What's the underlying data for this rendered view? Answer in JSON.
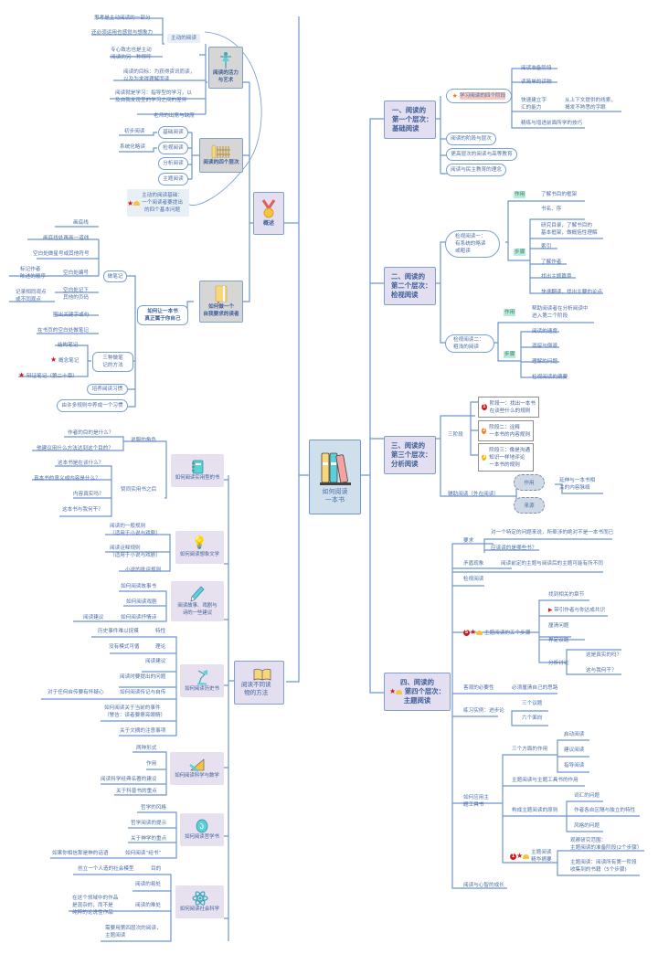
{
  "central": {
    "title_line1": "如何阅读",
    "title_line2": "一本书",
    "icon": "books-icon"
  },
  "right": {
    "level1": {
      "title": [
        "一、阅读的",
        "第一个层次：",
        "基础阅读"
      ],
      "stages_label": "学习阅读的四个阶段",
      "stages": [
        "阅读准备阶段",
        "读简单的读物",
        "快速建立字\n汇的能力",
        "精练与增进前面所学的技巧"
      ],
      "stage3_detail": "从上下文提供的线索，\n揭发不熟悉的字眼",
      "others": [
        "阅读的阶段与层次",
        "更高层次的阅读与高等教育",
        "阅读与民主教育的理念"
      ]
    },
    "level2": {
      "title": [
        "二、阅读的",
        "第二个层次：",
        "检视阅读"
      ],
      "part1": {
        "label": "检视阅读一：\n有系统的略读\n或粗读",
        "function_tag": "作用",
        "function": "了解书目的框架",
        "steps_tag": "步骤",
        "steps": [
          "书名、序",
          "研究目录，了解书目的\n基本框架，做概括性理解",
          "索引",
          "了解作者",
          "找出主题篇章",
          "快速翻读，找出主要的论点"
        ]
      },
      "part2": {
        "label": "检视阅读二：\n粗浅的阅读",
        "function_tag": "作用",
        "function": "帮助阅读者在分析阅读中\n进入第二个阶段",
        "steps_tag": "步骤",
        "steps": [
          "阅读的速度",
          "逗留与倒退",
          "理解的问题",
          "检视阅读的摘要"
        ]
      }
    },
    "level3": {
      "title": [
        "三、阅读的",
        "第三个层次：",
        "分析阅读"
      ],
      "three_stages_label": "三阶段",
      "stages": [
        {
          "num": "1",
          "color": "#d2191d",
          "text": "阶段一：找出一本书\n在谈些什么的规则"
        },
        {
          "num": "2",
          "color": "#f07b22",
          "text": "阶段二：诠释\n一本书的内容规则"
        },
        {
          "num": "3",
          "color": "#f5b400",
          "text": "阶段三：像是沟通\n知识一样地评论\n一本书的规则"
        }
      ],
      "aux_label": "辅助阅读（外在阅读）",
      "clouds": [
        "作用",
        "来源"
      ],
      "cloud_detail": "延伸与一本书相\n关的内容脉络"
    },
    "level4": {
      "title": [
        "四、阅读的",
        "第四个层次：",
        "主题阅读"
      ],
      "requirement": {
        "label": "要求",
        "items": [
          "对一个特定的问题来说，所牵涉的绝对不是一本书而已",
          "应该读的是哪些书？"
        ]
      },
      "contradiction": {
        "label": "矛盾现象",
        "item": "阅读前定的主题与阅读后的主题可能有所不同"
      },
      "inspect": "检视阅读",
      "five_steps": {
        "num": "5",
        "label": "主题阅读的五个步骤",
        "items": [
          "找到相关的章节",
          "带引作者与你达成共识",
          "厘清问题",
          "界定议题",
          "分析讨论"
        ],
        "discussion": [
          "这是真实的吗？",
          "这与我何干？"
        ]
      },
      "objective": {
        "label": "客观的必要性",
        "item": "必须厘清自己的思路"
      },
      "practice": {
        "label": "练习实例：进步论",
        "items": [
          "三个议题",
          "六个面向"
        ]
      },
      "tool": {
        "label": "如何应用主\n题工具书",
        "three_aspects": {
          "label": "三个方面的作用",
          "items": [
            "启动阅读",
            "建议阅读",
            "指导阅读"
          ]
        },
        "tool_role": "主题阅读与主题工具书的作用",
        "principles": {
          "label": "构成主题阅读的原则",
          "items": [
            "词汇的问题",
            "作者各自区隔与独立的特性",
            "风格的问题"
          ]
        },
        "summary": {
          "num": "1",
          "label": "主题阅读\n精华摘要",
          "items": [
            "观察研究范围：\n主题阅读的准备阶段(2个步骤）",
            "主题阅读：阅读所有第一阶段\n收集到的书籍（5个步骤)"
          ]
        }
      },
      "growth": "阅读与心智的成长"
    }
  },
  "left": {
    "overview": {
      "title": "概述",
      "art": {
        "title": "阅读的活力\n与艺术",
        "active_label": "主动的阅读",
        "active_items": [
          "思考是主动阅读的一部分",
          "还必须运用也感觉与想象力",
          "专心致志也是主动\n阅读的另一种称呼"
        ],
        "items": [
          "阅读的目标：为获得资讯而读，\n以及为求得理解而读",
          "阅读就是学习：指导型的学习，以\n及自我发现型的学习之间的差异",
          "老师的出席与缺席"
        ]
      },
      "levels": {
        "title": "阅读的四个层次",
        "pills": [
          "基础阅读",
          "检视阅读",
          "分析阅读",
          "主题阅读"
        ],
        "pill_notes": [
          "初步阅读",
          "系统化略读"
        ]
      },
      "foundation": "主动的阅读基础：\n一个阅读者要提出\n的四个基本问题",
      "demanding": {
        "title": "如何做一个\n自我要求的读者",
        "own_book": "如何让一本书\n真正属于你自己",
        "notes": {
          "label": "做笔记",
          "items": [
            "画底线",
            "画底线处再画一道线",
            "空白处做星号或其他符号",
            "空白处编号",
            "空白处记下\n其他的页码",
            "圈出关键字或句",
            "在书页的空白处做笔记"
          ],
          "numbering_note": "标记作者\n陈述的顺序",
          "pages_note": "记录相同观点\n或不同观点"
        },
        "three_notes": {
          "label": "三种做笔\n记的方法",
          "items": [
            "结构笔记",
            "概念笔记",
            "辩证笔记（第二十章）"
          ]
        },
        "habit": "培养阅读习惯",
        "rules_habit": "由许多规则中养成一个习惯"
      }
    },
    "methods": {
      "title": "阅读不同读\n物的方法",
      "practical": {
        "title": "如何阅读实用型的书",
        "persuasion": {
          "label": "说服的角色",
          "items": [
            "作者的目的是什么？",
            "他建议用什么方法达到这个目的？"
          ]
        },
        "after": {
          "label": "赞同实用书之后",
          "items": [
            "这本书是在谈什么？",
            "真本书的意义或内容是什么？",
            "内容真实吗？",
            "这本书与我何干？"
          ]
        }
      },
      "imaginative": {
        "title": "如何阅读想象文学",
        "items": [
          "阅读的一般规则\n（适用于小说与戏剧）",
          "阅读诠释规则\n（适用于小说与戏剧）",
          "小说的批评规则"
        ]
      },
      "stories": {
        "title": "阅读故事、戏剧与\n诗的一些建议",
        "items": [
          "如何阅读故事书",
          "如何阅读戏剧",
          "如何阅读抒情诗"
        ],
        "advice": "阅读建议"
      },
      "history": {
        "title": "如何阅读历史书",
        "items": [
          "特性",
          "理论",
          "阅读建议",
          "阅读时要提出的问题",
          "如何阅读传记与自传",
          "如何阅读关于当前的事件\n（警告：读者要擦亮眼睛）",
          "关于文摘的注意事项"
        ],
        "notes": [
          "历史事件难以捉摸",
          "没有模式可循",
          "",
          "",
          "对于任何自传要有怀疑心"
        ]
      },
      "science": {
        "title": "如何阅读科学与数学",
        "items": [
          "两种形式",
          "作用",
          "阅读科学经典名著的建议",
          "关于科普书的重点"
        ]
      },
      "philosophy": {
        "title": "如何阅读哲学书",
        "items": [
          "哲学的风格",
          "哲学阅读的提示",
          "关于神学的重点",
          "如何阅读“经书”"
        ],
        "note": "如果你相信那是神的话语"
      },
      "social": {
        "title": "如何阅读社会科学",
        "items": [
          "目的",
          "阅读的易处",
          "阅读的难处",
          "需要用第四层次的阅读，\n主题阅读"
        ],
        "purpose_note": "创立一个人造的社会模型",
        "difficulty_note": "在这个领域中的作品\n是混杂的，而不是\n纯粹的论说性作品"
      }
    }
  },
  "colors": {
    "line": "#6f95cf",
    "text": "#4a6ea8",
    "lavender": "#e3dff0",
    "gray_box": "#d6d6d6",
    "star": "#d2191d",
    "tag": "#b9ecd9",
    "highlight": "#f8c9c0"
  }
}
